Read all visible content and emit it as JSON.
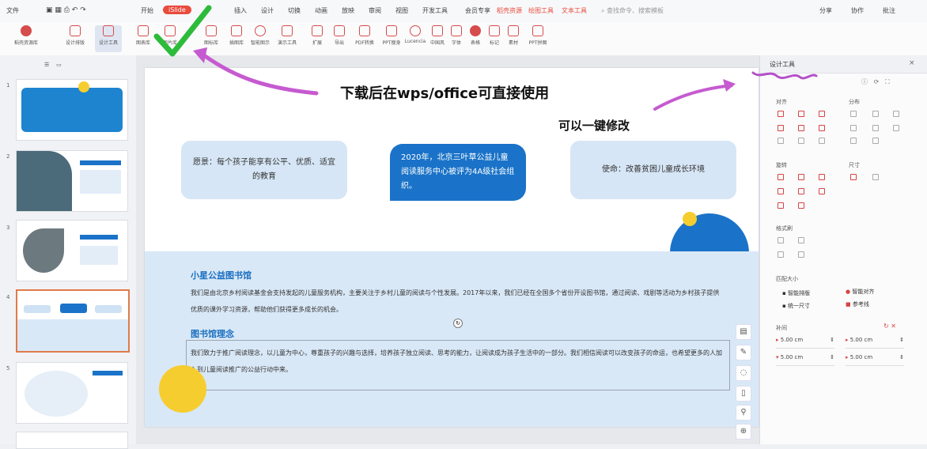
{
  "menu": {
    "file": "文件",
    "tabs": [
      "开始",
      "插入",
      "设计",
      "切换",
      "动画",
      "放映",
      "审阅",
      "视图",
      "开发工具",
      "会员专享",
      "稻壳资源",
      "绘图工具",
      "文本工具"
    ],
    "active_tab": "iSlide",
    "search_placeholder": "查找命令、搜索模板",
    "right": [
      "分享",
      "协作",
      "批注"
    ]
  },
  "ribbon": {
    "tools": [
      "稻壳资源库",
      "设计排版",
      "设计工具",
      "图表库",
      "图片库",
      "图标库",
      "插图库",
      "智能图示",
      "演示工具",
      "扩展",
      "导出",
      "PDF转换",
      "PPT瘦身",
      "Lucencia",
      "中国风",
      "字体",
      "表格",
      "标记",
      "素材",
      "PPT拼图"
    ]
  },
  "slides": [
    {
      "num": "1",
      "selected": false
    },
    {
      "num": "2",
      "selected": false
    },
    {
      "num": "3",
      "selected": false
    },
    {
      "num": "4",
      "selected": true
    },
    {
      "num": "5",
      "selected": false
    }
  ],
  "slide": {
    "cards": [
      {
        "text": "愿景：每个孩子能享有公平、优质、适宜的教育"
      },
      {
        "text": "2020年，北京三叶草公益儿童阅读服务中心被评为4A级社会组织。"
      },
      {
        "text": "使命：改善贫困儿童成长环境"
      }
    ],
    "section1_title": "小星公益图书馆",
    "section1_body": "我们是由北京乡村阅读基金会支持发起的儿童服务机构，主要关注于乡村儿童的阅读与个性发展。2017年以来，我们已经在全国多个省份开设图书馆，通过阅读、戏剧等活动为乡村孩子提供优质的课外学习资源，帮助他们获得更多成长的机会。",
    "section2_title": "图书馆理念",
    "section2_body": "我们致力于推广阅读理念，以儿童为中心，尊重孩子的兴趣与选择，培养孩子独立阅读、思考的能力，让阅读成为孩子生活中的一部分。我们相信阅读可以改变孩子的命运，也希望更多的人加入到儿童阅读推广的公益行动中来。"
  },
  "annotations": {
    "main": "下载后在wps/office可直接使用",
    "secondary": "可以一键修改"
  },
  "right_panel": {
    "title": "设计工具",
    "sections": [
      "对齐",
      "分布",
      "旋转",
      "尺寸",
      "格式刷",
      "匹配大小",
      "补间"
    ],
    "actions": [
      "智能排版",
      "智能对齐",
      "统一尺寸",
      "参考线"
    ],
    "inputs": [
      "5.00 cm",
      "5.00 cm",
      "5.00 cm",
      "5.00 cm"
    ]
  }
}
